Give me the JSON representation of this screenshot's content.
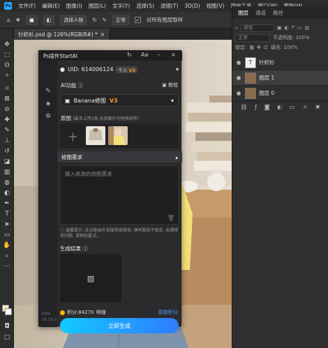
{
  "menubar": {
    "logo": "Ps",
    "items": [
      "文件(F)",
      "编辑(E)",
      "图像(I)",
      "图层(L)",
      "文字(Y)",
      "选择(S)",
      "滤镜(T)",
      "3D(D)",
      "视图(V)",
      "增效工具",
      "窗口(W)",
      "帮助(H)"
    ]
  },
  "options": {
    "select_subject": "选择人物",
    "sample_mode": "正常",
    "all_layers_sample": "对所有图层取样"
  },
  "document_tab": {
    "title": "针织衫.psd @ 126%(RGB/8#) *",
    "close": "×"
  },
  "layers_panel": {
    "tabs": [
      "图层",
      "通道",
      "路径"
    ],
    "kind_filter": "类型",
    "blend_mode": "正常",
    "opacity": "不透明度: 100%",
    "lock_label": "锁定:",
    "fill": "填充: 100%",
    "layers": [
      {
        "name": "针织衫",
        "thumb": "T"
      },
      {
        "name": "图层 1"
      },
      {
        "name": "图层 0"
      }
    ]
  },
  "plugin": {
    "title": "Ps插件StartAI",
    "uid": "UID: 614006124",
    "account_type": "个人",
    "account_level": "V3",
    "ai_function_label": "AI功能",
    "tutorial": "教程",
    "model": "Banana修图",
    "model_version": "V3",
    "source_label": "原图",
    "source_hint": "(最多上传5张,长按图片可拖拽排序)",
    "request_label": "修图需求",
    "request_placeholder": "输入修改的修图需求",
    "tip": "温馨提示: 此功能由外部服务商提供, 偶有服务不稳定, 如遇使用问题, 请稍后重试。",
    "result_label": "生成结果",
    "points": "积分:84270",
    "points_short": "明细",
    "get_points": "获取积分",
    "generate": "立即生成",
    "beta": "beta",
    "version": "V5.10.3"
  }
}
